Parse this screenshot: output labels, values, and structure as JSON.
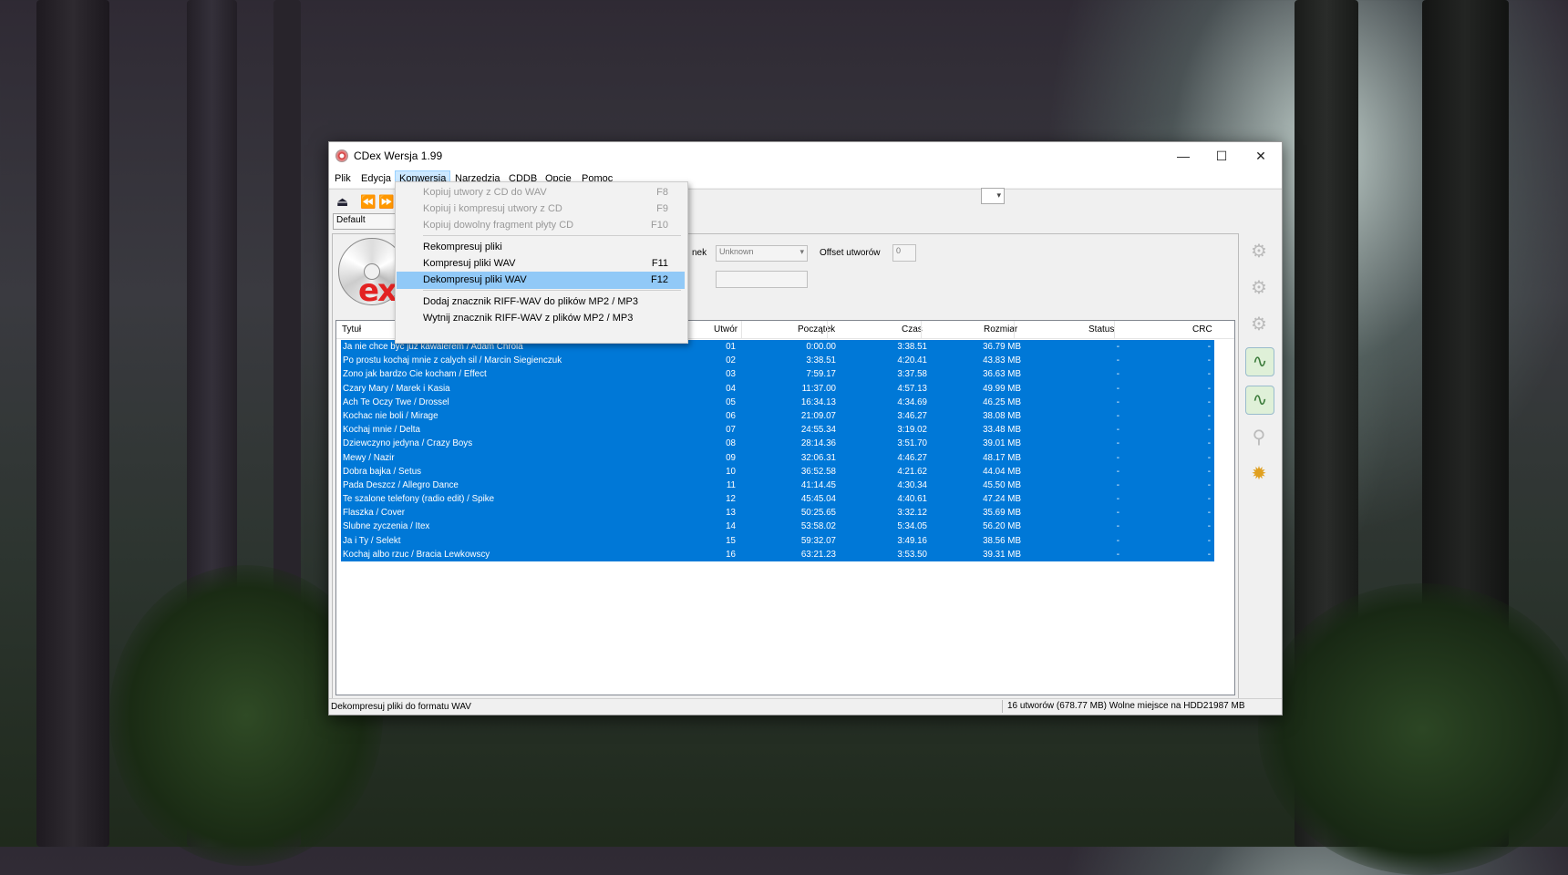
{
  "window": {
    "title": "CDex Wersja 1.99",
    "controls": {
      "minimize": "—",
      "maximize": "☐",
      "close": "✕"
    }
  },
  "menu": [
    "Plik",
    "Edycja",
    "Konwersja",
    "Narzędzia",
    "CDDB",
    "Opcje",
    "Pomoc"
  ],
  "toolbar": {
    "profile": "Default",
    "genre_label": "nek",
    "genre_value": "Unknown",
    "offset_label": "Offset utworów",
    "offset_value": "0"
  },
  "dropdown": {
    "items": [
      {
        "label": "Kopiuj utwory z CD do WAV",
        "key": "F8",
        "disabled": true
      },
      {
        "label": "Kopiuj i kompresuj utwory z CD",
        "key": "F9",
        "disabled": true
      },
      {
        "label": "Kopiuj dowolny fragment płyty CD",
        "key": "F10",
        "disabled": true
      },
      {
        "label": "Rekompresuj pliki",
        "key": "",
        "disabled": false
      },
      {
        "label": "Kompresuj pliki WAV",
        "key": "F11",
        "disabled": false
      },
      {
        "label": "Dekompresuj pliki WAV",
        "key": "F12",
        "disabled": false,
        "highlighted": true
      },
      {
        "label": "Dodaj znacznik RIFF-WAV do plików MP2 / MP3",
        "key": "",
        "disabled": false
      },
      {
        "label": "Wytnij znacznik RIFF-WAV z plików MP2 / MP3",
        "key": "",
        "disabled": false
      }
    ]
  },
  "table": {
    "columns": [
      "Tytuł",
      "Utwór",
      "Początek",
      "Czas",
      "Rozmiar",
      "Status",
      "CRC"
    ],
    "rows": [
      [
        "Ja  nie chce byc juz kawalerem / Adam Chrola",
        "01",
        "0:00.00",
        "3:38.51",
        "36.79 MB",
        "-",
        "-"
      ],
      [
        "Po prostu kochaj mnie z calych sil / Marcin Siegienczuk",
        "02",
        "3:38.51",
        "4:20.41",
        "43.83 MB",
        "-",
        "-"
      ],
      [
        "Zono jak bardzo Cie kocham / Effect",
        "03",
        "7:59.17",
        "3:37.58",
        "36.63 MB",
        "-",
        "-"
      ],
      [
        "Czary Mary / Marek i Kasia",
        "04",
        "11:37.00",
        "4:57.13",
        "49.99 MB",
        "-",
        "-"
      ],
      [
        "Ach Te Oczy Twe / Drossel",
        "05",
        "16:34.13",
        "4:34.69",
        "46.25 MB",
        "-",
        "-"
      ],
      [
        "Kochac nie boli / Mirage",
        "06",
        "21:09.07",
        "3:46.27",
        "38.08 MB",
        "-",
        "-"
      ],
      [
        "Kochaj mnie / Delta",
        "07",
        "24:55.34",
        "3:19.02",
        "33.48 MB",
        "-",
        "-"
      ],
      [
        "Dziewczyno jedyna / Crazy Boys",
        "08",
        "28:14.36",
        "3:51.70",
        "39.01 MB",
        "-",
        "-"
      ],
      [
        "Mewy / Nazir",
        "09",
        "32:06.31",
        "4:46.27",
        "48.17 MB",
        "-",
        "-"
      ],
      [
        "Dobra bajka / Setus",
        "10",
        "36:52.58",
        "4:21.62",
        "44.04 MB",
        "-",
        "-"
      ],
      [
        "Pada Deszcz / Allegro Dance",
        "11",
        "41:14.45",
        "4:30.34",
        "45.50 MB",
        "-",
        "-"
      ],
      [
        "Te szalone telefony (radio edit) / Spike",
        "12",
        "45:45.04",
        "4:40.61",
        "47.24 MB",
        "-",
        "-"
      ],
      [
        "Flaszka / Cover",
        "13",
        "50:25.65",
        "3:32.12",
        "35.69 MB",
        "-",
        "-"
      ],
      [
        "Slubne zyczenia / Itex",
        "14",
        "53:58.02",
        "5:34.05",
        "56.20 MB",
        "-",
        "-"
      ],
      [
        "Ja i Ty / Selekt",
        "15",
        "59:32.07",
        "3:49.16",
        "38.56 MB",
        "-",
        "-"
      ],
      [
        "Kochaj albo rzuc / Bracia Lewkowscy",
        "16",
        "63:21.23",
        "3:53.50",
        "39.31 MB",
        "-",
        "-"
      ]
    ]
  },
  "status": {
    "left": "Dekompresuj pliki do formatu WAV",
    "right": "16 utworów (678.77 MB) Wolne miejsce na HDD21987 MB"
  },
  "colors": {
    "selection": "#0078d7",
    "menu_highlight": "#91c9f7",
    "logo_red": "#e32222"
  }
}
